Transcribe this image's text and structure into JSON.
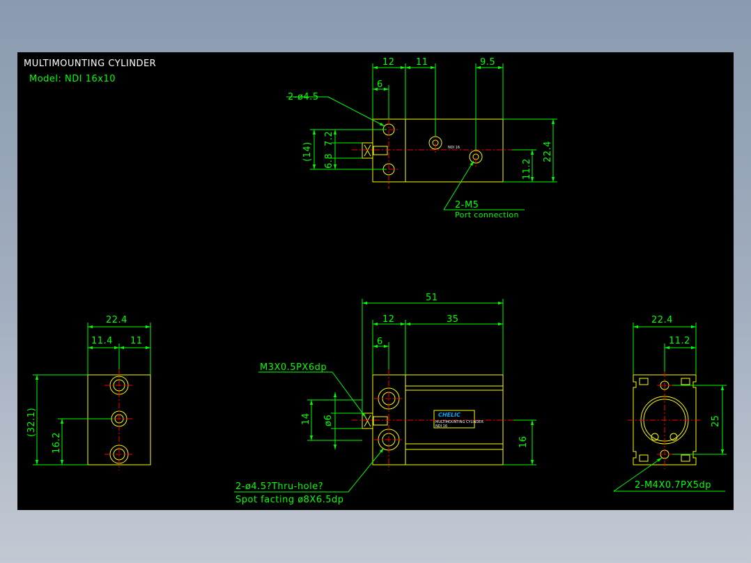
{
  "title": "MULTIMOUNTING CYLINDER",
  "model": "Model: NDI 16x10",
  "colors": {
    "background": "#000000",
    "outline": "#ffff00",
    "dimension": "#00ff00",
    "centerline": "#ff0000",
    "text": "#ffffff",
    "logo": "#00a8ff"
  },
  "top_view": {
    "dims": {
      "d12": "12",
      "d11": "11",
      "d9_5": "9.5",
      "d6": "6",
      "d14": "(14)",
      "d6_8": "6.8",
      "d7_2": "7.2",
      "d22_4": "22.4",
      "d11_2": "11.2"
    },
    "callouts": {
      "holes": "2-ø4.5",
      "ports": "2-M5",
      "ports_note": "Port connection"
    },
    "body_label": "NDI 16"
  },
  "left_view": {
    "dims": {
      "d22_4": "22.4",
      "d11_4": "11.4",
      "d11": "11",
      "d32_1": "(32.1)",
      "d16_2": "16.2"
    }
  },
  "front_view": {
    "dims": {
      "d51": "51",
      "d12": "12",
      "d35": "35",
      "d6": "6",
      "d14": "14",
      "d_phi6": "ø6",
      "d16": "16"
    },
    "callouts": {
      "thread": "M3X0.5PX6dp",
      "holes": "2-ø4.5?Thru-hole?",
      "holes_note": "Spot facting  ø8X6.5dp"
    },
    "label": {
      "brand": "CHELIC",
      "line1": "MULTIMOUNTING CYLINDER",
      "line2": "NDI 16"
    }
  },
  "right_view": {
    "dims": {
      "d22_4": "22.4",
      "d11_2": "11.2",
      "d25": "25"
    },
    "callouts": {
      "holes": "2-M4X0.7PX5dp"
    }
  }
}
